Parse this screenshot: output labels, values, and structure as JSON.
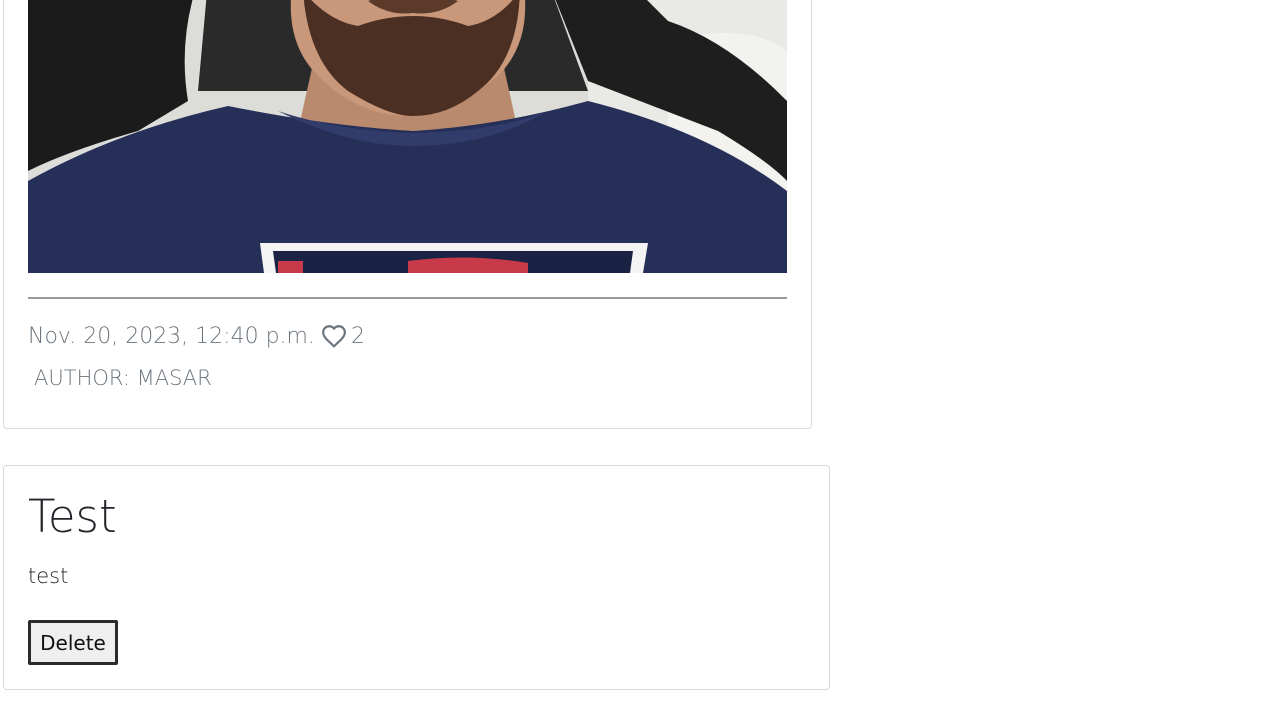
{
  "posts": [
    {
      "date": "Nov. 20, 2023, 12:40 p.m.",
      "likes": "2",
      "author": "AUTHOR: MASAR",
      "like_icon": "heart-outline-icon"
    },
    {
      "title": "Test",
      "body": "test",
      "delete_label": "Delete"
    }
  ],
  "colors": {
    "border": "#d9d9d9",
    "muted_text": "#6c757d",
    "text": "#212529",
    "shirt": "#26305a",
    "chair": "#1f1f1f"
  }
}
